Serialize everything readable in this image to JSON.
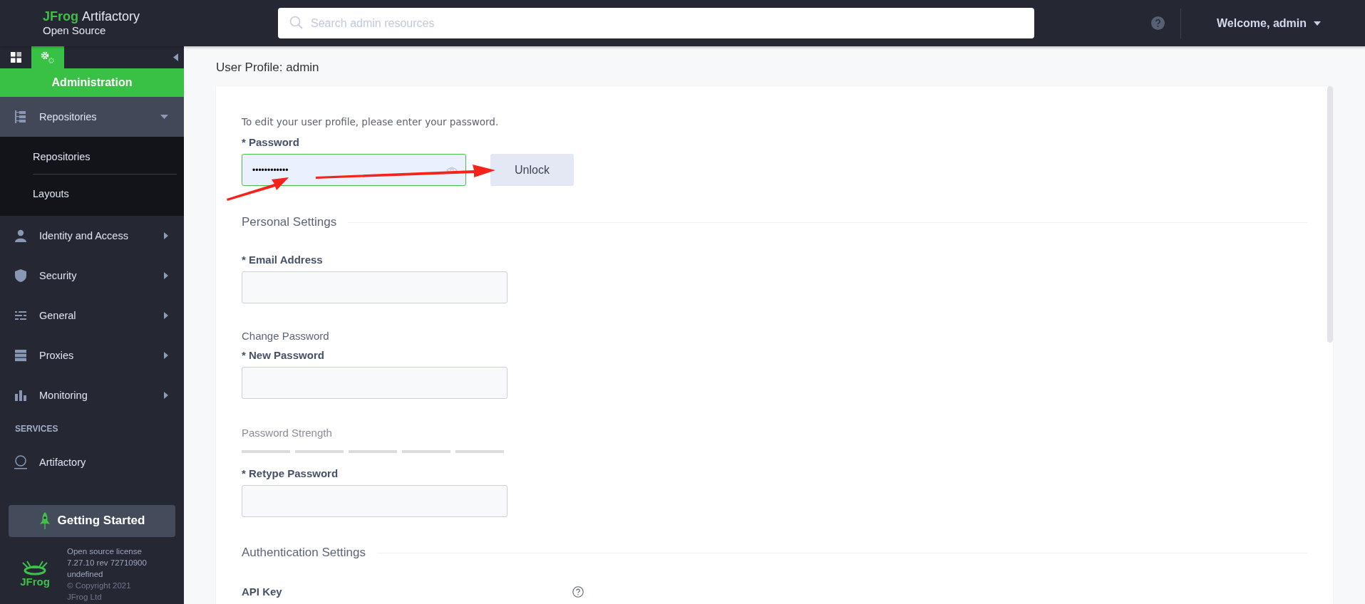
{
  "header": {
    "brand": "JFrog",
    "product": "Artifactory",
    "edition": "Open Source",
    "search": {
      "placeholder": "Search admin resources"
    },
    "user_menu": "Welcome, admin"
  },
  "sidebar": {
    "tabs": [
      {
        "kind": "dashboard",
        "selected": false
      },
      {
        "kind": "admin",
        "selected": true
      }
    ],
    "section_title": "Administration",
    "items": [
      {
        "label": "Repositories",
        "kind": "repositories",
        "expanded": true,
        "children": [
          {
            "label": "Repositories"
          },
          {
            "label": "Layouts"
          }
        ]
      },
      {
        "label": "Identity and Access",
        "kind": "identity",
        "expanded": false
      },
      {
        "label": "Security",
        "kind": "security",
        "expanded": false
      },
      {
        "label": "General",
        "kind": "general",
        "expanded": false
      },
      {
        "label": "Proxies",
        "kind": "proxies",
        "expanded": false
      },
      {
        "label": "Monitoring",
        "kind": "monitoring",
        "expanded": false
      }
    ],
    "services_title": "SERVICES",
    "services": [
      {
        "label": "Artifactory"
      }
    ],
    "getting_started": "Getting Started",
    "footer": {
      "logo": "JFrog",
      "lines": [
        "Open source license",
        "7.27.10 rev 72710900",
        "undefined"
      ],
      "copyright": "© Copyright 2021 JFrog Ltd"
    }
  },
  "page": {
    "title": "User Profile: admin",
    "intro": "To edit your user profile, please enter your password.",
    "password": {
      "label": "* Password",
      "value": "••••••••••••"
    },
    "unlock_button": "Unlock",
    "personal_settings": {
      "title": "Personal Settings",
      "email_label": "* Email Address",
      "change_password": "Change Password",
      "new_password_label": "* New Password",
      "strength_label": "Password Strength",
      "strength": {
        "level": 0
      },
      "retype_label": "* Retype Password"
    },
    "authentication_settings": {
      "title": "Authentication Settings",
      "api_key_label": "API Key"
    }
  }
}
